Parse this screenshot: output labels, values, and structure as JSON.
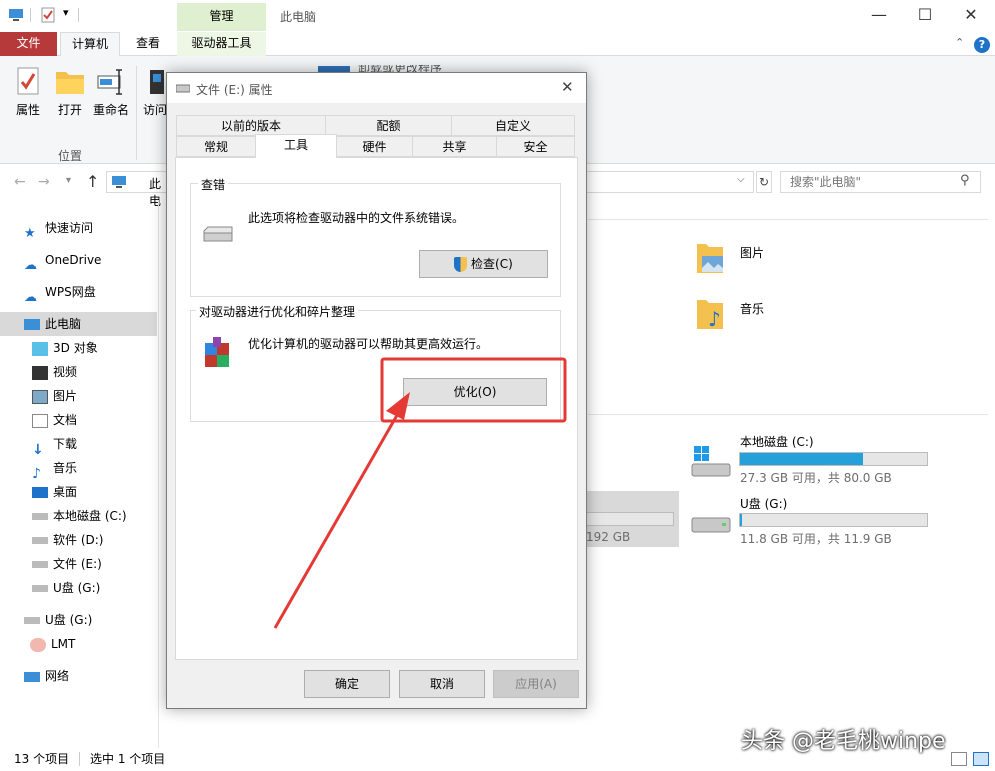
{
  "window": {
    "context_tab": "管理",
    "title": "此电脑",
    "minimize": "—",
    "maximize": "☐",
    "close": "✕"
  },
  "ribbon": {
    "tabs": {
      "file": "文件",
      "computer": "计算机",
      "view": "查看",
      "drive_tools": "驱动器工具"
    },
    "buttons": {
      "properties": "属性",
      "open": "打开",
      "rename": "重命名",
      "access": "访问"
    },
    "group_location": "位置",
    "obscured_text": "卸载或更改程序"
  },
  "address": {
    "breadcrumb": "此电",
    "search_placeholder": "搜索\"此电脑\""
  },
  "nav": {
    "items": [
      {
        "label": "快速访问",
        "icon": "star-icon"
      },
      {
        "label": "OneDrive",
        "icon": "cloud-icon"
      },
      {
        "label": "WPS网盘",
        "icon": "cloud-icon"
      },
      {
        "label": "此电脑",
        "icon": "computer-icon"
      },
      {
        "label": "3D 对象",
        "icon": "cube-icon"
      },
      {
        "label": "视频",
        "icon": "video-icon"
      },
      {
        "label": "图片",
        "icon": "picture-icon"
      },
      {
        "label": "文档",
        "icon": "document-icon"
      },
      {
        "label": "下载",
        "icon": "download-icon"
      },
      {
        "label": "音乐",
        "icon": "music-icon"
      },
      {
        "label": "桌面",
        "icon": "desktop-icon"
      },
      {
        "label": "本地磁盘 (C:)",
        "icon": "drive-icon"
      },
      {
        "label": "软件 (D:)",
        "icon": "drive-icon"
      },
      {
        "label": "文件 (E:)",
        "icon": "drive-icon"
      },
      {
        "label": "U盘 (G:)",
        "icon": "drive-icon"
      },
      {
        "label": "U盘 (G:)",
        "icon": "usb-icon"
      },
      {
        "label": "LMT",
        "icon": "user-icon"
      },
      {
        "label": "网络",
        "icon": "network-icon"
      }
    ]
  },
  "content": {
    "folders": [
      {
        "label": "图片"
      },
      {
        "label": "音乐"
      }
    ],
    "drives": [
      {
        "name": "本地磁盘 (C:)",
        "info": "27.3 GB 可用，共 80.0 GB",
        "fill": 0.66
      },
      {
        "name": "U盘 (G:)",
        "info": "11.8 GB 可用，共 11.9 GB",
        "fill": 0.01
      }
    ],
    "partial_size": "192 GB"
  },
  "status": {
    "count": "13 个项目",
    "selected": "选中 1 个项目"
  },
  "dialog": {
    "title": "文件 (E:) 属性",
    "tabs_row1": [
      "以前的版本",
      "配额",
      "自定义"
    ],
    "tabs_row2": [
      "常规",
      "工具",
      "硬件",
      "共享",
      "安全"
    ],
    "check_group": {
      "title": "查错",
      "desc": "此选项将检查驱动器中的文件系统错误。",
      "button": "检查(C)"
    },
    "optimize_group": {
      "title": "对驱动器进行优化和碎片整理",
      "desc": "优化计算机的驱动器可以帮助其更高效运行。",
      "button": "优化(O)"
    },
    "ok": "确定",
    "cancel": "取消",
    "apply": "应用(A)"
  },
  "watermark": "头条 @老毛桃winpe",
  "colors": {
    "annotation": "#e53935",
    "accent": "#26a0da",
    "file_tab": "#b73a3a"
  }
}
